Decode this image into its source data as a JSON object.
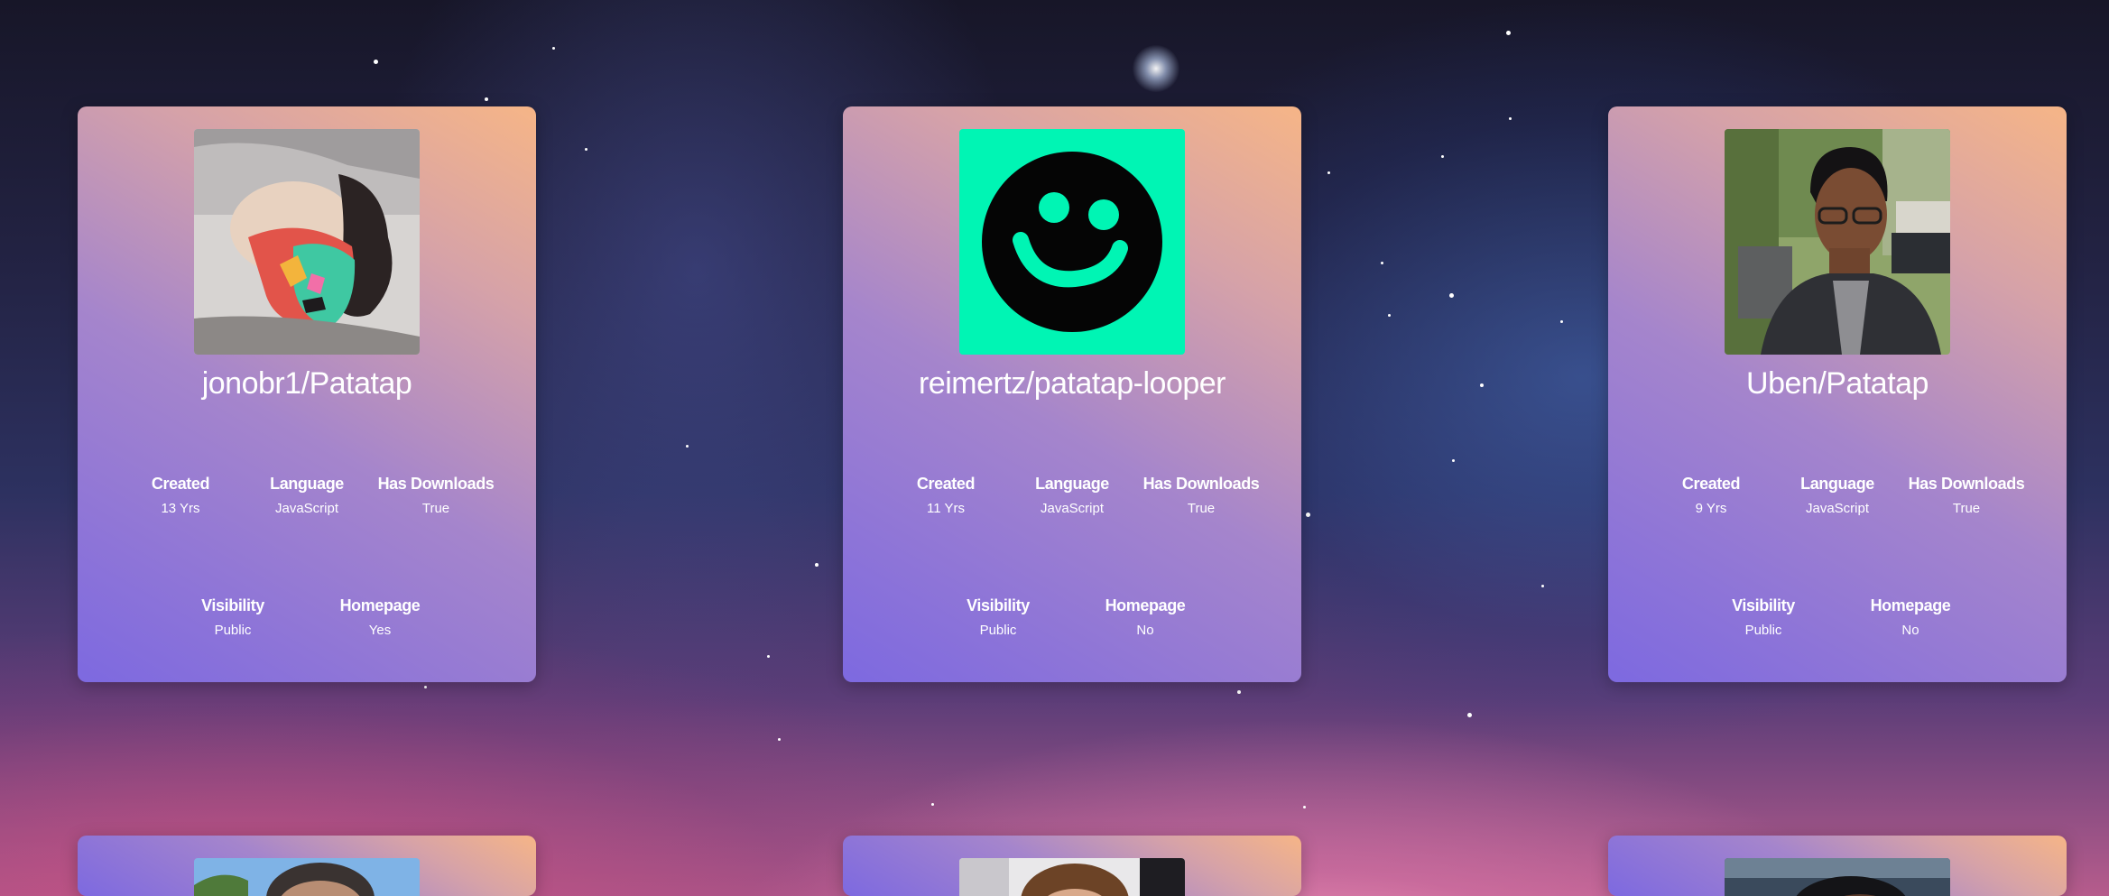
{
  "stat_labels": {
    "created": "Created",
    "language": "Language",
    "has_downloads": "Has Downloads",
    "visibility": "Visibility",
    "homepage": "Homepage"
  },
  "cards": [
    {
      "repo": "jonobr1/Patatap",
      "avatar": "masked-person-lying-photo",
      "created": "13 Yrs",
      "language": "JavaScript",
      "has_downloads": "True",
      "visibility": "Public",
      "homepage": "Yes"
    },
    {
      "repo": "reimertz/patatap-looper",
      "avatar": "smiley-face-logo",
      "created": "11 Yrs",
      "language": "JavaScript",
      "has_downloads": "True",
      "visibility": "Public",
      "homepage": "No"
    },
    {
      "repo": "Uben/Patatap",
      "avatar": "man-with-glasses-photo",
      "created": "9 Yrs",
      "language": "JavaScript",
      "has_downloads": "True",
      "visibility": "Public",
      "homepage": "No"
    }
  ],
  "colors": {
    "smiley_background": "#00f5b4",
    "smiley_face": "#050505",
    "card_gradient_start": "#7d69e0",
    "card_gradient_end": "#f6b587"
  }
}
